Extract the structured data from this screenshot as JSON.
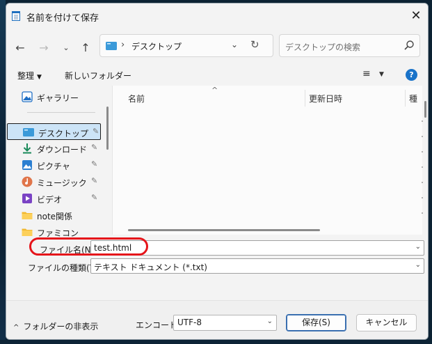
{
  "window": {
    "title": "名前を付けて保存",
    "close_glyph": "✕"
  },
  "nav": {
    "back": "←",
    "forward": "→",
    "recent": "⌄",
    "up": "↑",
    "address_sep": "›",
    "address": "デスクトップ",
    "address_dropdown": "⌄",
    "refresh": "↻",
    "search_placeholder": "デスクトップの検索"
  },
  "toolbar": {
    "organize": "整理",
    "organize_caret": "▼",
    "new_folder": "新しいフォルダー",
    "view_glyph": "≡",
    "view_caret": "▼",
    "help": "?"
  },
  "sidebar": {
    "items": [
      {
        "label": "ギャラリー",
        "icon": "gallery-icon",
        "pinned": false
      },
      {
        "label": "デスクトップ",
        "icon": "desktop-icon",
        "pinned": true,
        "selected": true
      },
      {
        "label": "ダウンロード",
        "icon": "download-icon",
        "pinned": true
      },
      {
        "label": "ピクチャ",
        "icon": "pictures-icon",
        "pinned": true
      },
      {
        "label": "ミュージック",
        "icon": "music-icon",
        "pinned": true
      },
      {
        "label": "ビデオ",
        "icon": "video-icon",
        "pinned": true
      },
      {
        "label": "note関係",
        "icon": "folder-icon",
        "pinned": false
      },
      {
        "label": "ファミコン",
        "icon": "folder-icon",
        "pinned": false
      }
    ],
    "pin_glyph": "📌"
  },
  "filelist": {
    "sort_glyph": "^",
    "columns": [
      "名前",
      "更新日時",
      "種"
    ]
  },
  "fields": {
    "filename_label": "ファイル名(N):",
    "filename_value": "test.html",
    "filetype_label": "ファイルの種類(T):",
    "filetype_value": "テキスト ドキュメント (*.txt)",
    "dropdown_glyph": "⌄"
  },
  "footer": {
    "toggle_chevron": "^",
    "toggle_label": "フォルダーの非表示",
    "encoding_label": "エンコード:",
    "encoding_value": "UTF-8",
    "save": "保存(S)",
    "cancel": "キャンセル"
  },
  "colors": {
    "accent": "#1a73c9",
    "selection": "#cce4f7",
    "highlight_ring": "#e5141a"
  }
}
